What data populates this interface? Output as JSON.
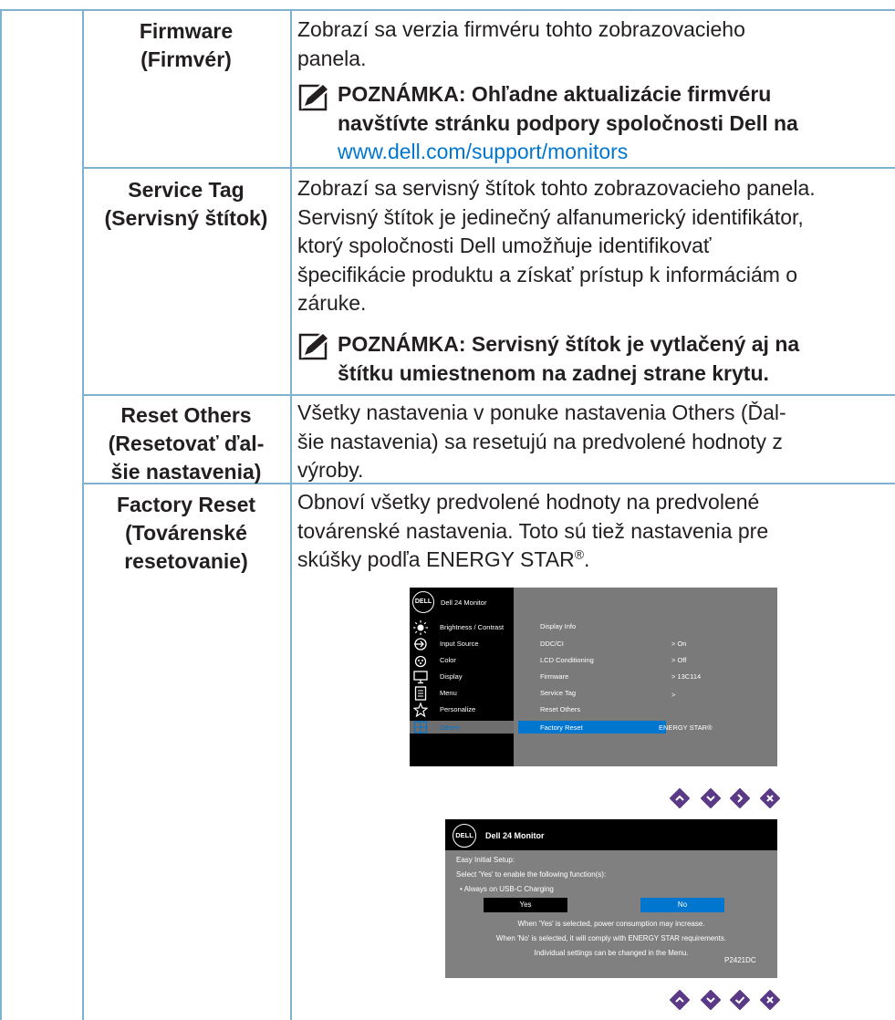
{
  "rows": [
    {
      "header": [
        "Firmware",
        "(Firmvér)"
      ],
      "desc": [
        "Zobrazí sa verzia firmvéru tohto zobrazovacieho",
        "panela."
      ],
      "note": [
        "POZNÁMKA: Ohľadne aktualizácie firmvéru",
        "navštívte stránku podpory spoločnosti Dell na"
      ],
      "link": "www.dell.com/support/monitors"
    },
    {
      "header": [
        "Service Tag",
        "(Servisný štítok)"
      ],
      "desc": [
        "Zobrazí sa servisný štítok tohto zobrazovacieho panela.",
        "Servisný štítok je jedinečný alfanumerický identifikátor,",
        "ktorý spoločnosti Dell umožňuje identifikovať",
        "špecifikácie produktu a získať prístup k informáciám o",
        "záruke."
      ],
      "note": [
        "POZNÁMKA: Servisný štítok je vytlačený aj na",
        "štítku umiestnenom na zadnej strane krytu."
      ]
    },
    {
      "header": [
        "Reset Others",
        "(Resetovať ďal-",
        "šie nastavenia)"
      ],
      "desc": [
        "Všetky nastavenia v ponuke nastavenia Others (Ďal-",
        "šie nastavenia) sa resetujú na predvolené hodnoty z",
        "výroby."
      ]
    },
    {
      "header": [
        "Factory Reset",
        "(Továrenské",
        "resetovanie)"
      ],
      "desc": [
        "Obnoví všetky predvolené hodnoty na predvolené",
        "továrenské nastavenia. Toto sú tiež nastavenia pre",
        "skúšky podľa ENERGY STAR"
      ],
      "desc_sup": "®",
      "desc_end": "."
    }
  ],
  "osd_menu": {
    "logo": "DELL",
    "title": "Dell 24 Monitor",
    "menu_items": [
      "Brightness / Contrast",
      "Input Source",
      "Color",
      "Display",
      "Menu",
      "Personalize",
      "Others"
    ],
    "menu_icons": [
      "brightness-icon",
      "input-source-icon",
      "color-icon",
      "display-icon",
      "menu-icon",
      "star-icon",
      "others-icon"
    ],
    "submenu": [
      {
        "label": "Display Info",
        "value": ""
      },
      {
        "label": "DDC/CI",
        "value": ">  On"
      },
      {
        "label": "LCD Conditioning",
        "value": ">  Off"
      },
      {
        "label": "Firmware",
        "value": ">  13C114"
      },
      {
        "label": "Service Tag",
        "value": ">"
      },
      {
        "label": "Reset Others",
        "value": ""
      },
      {
        "label": "Factory Reset",
        "value": "ENERGY STAR®"
      }
    ]
  },
  "osd_dialog": {
    "logo": "DELL",
    "title": "Dell 24 Monitor",
    "lines": [
      "Easy Initial Setup:",
      "Select 'Yes' to enable the following function(s):",
      "• Always on USB-C Charging"
    ],
    "yes_label": "Yes",
    "no_label": "No",
    "footer": [
      "When 'Yes' is selected, power consumption may increase.",
      "When 'No' is selected, it will comply with ENERGY STAR requirements.",
      "Individual settings can be changed in the Menu."
    ],
    "model": "P2421DC"
  },
  "colors": {
    "table_line": "#7fb2d1",
    "link": "#0076ce",
    "osd_highlight": "#0076ce",
    "button_purple": "#5a3a86"
  }
}
